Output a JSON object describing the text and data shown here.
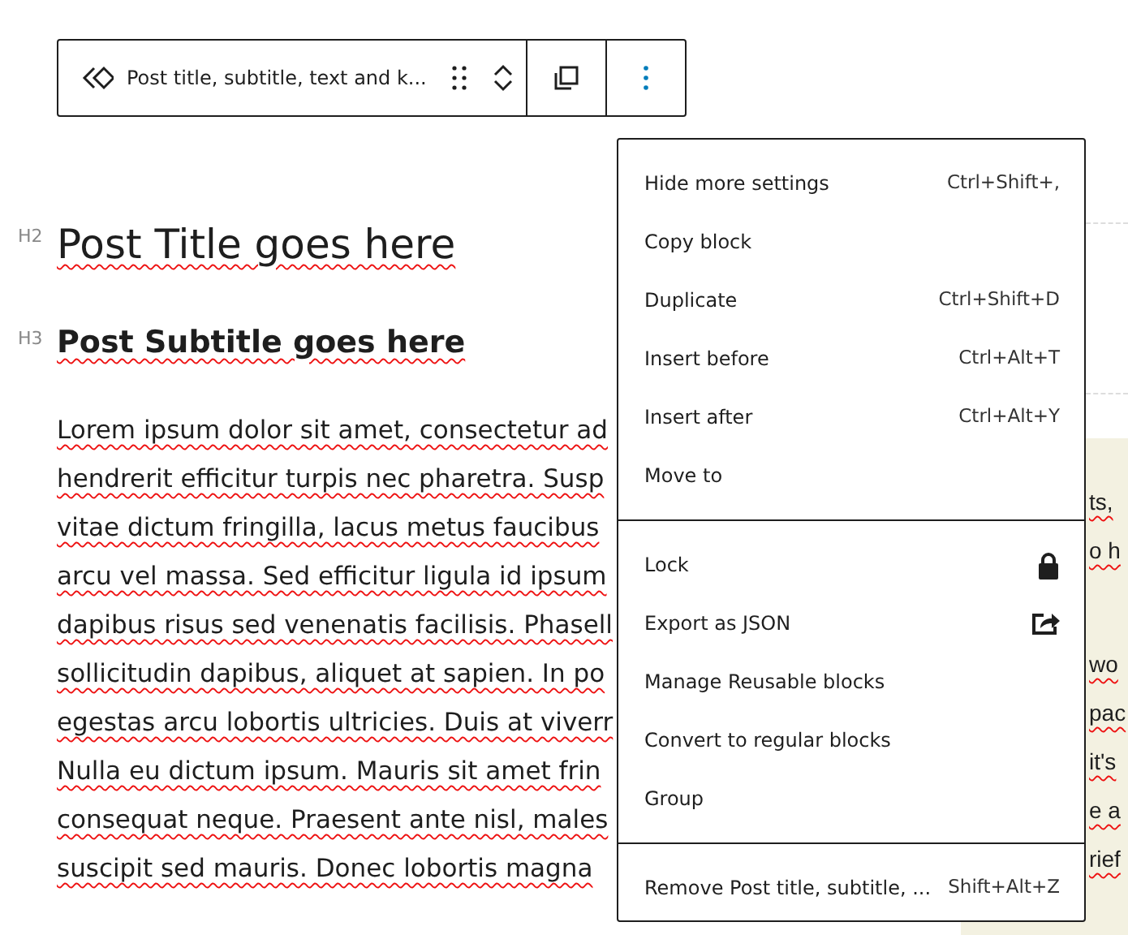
{
  "toolbar": {
    "block_label": "Post title, subtitle, text and k...",
    "more_active": true
  },
  "title": {
    "level": "H2",
    "text": "Post Title goes here"
  },
  "subtitle": {
    "level": "H3",
    "text": "Post Subtitle goes here"
  },
  "paragraph_lines": [
    "Lorem ipsum dolor sit amet, consectetur ad",
    "hendrerit efficitur turpis nec pharetra. Susp",
    "vitae dictum fringilla, lacus metus faucibus",
    "arcu vel massa. Sed efficitur ligula id ipsum",
    "dapibus risus sed venenatis facilisis. Phasell",
    "sollicitudin dapibus, aliquet at sapien. In po",
    "egestas arcu lobortis ultricies. Duis at viverr",
    "Nulla eu dictum ipsum. Mauris sit amet frin",
    "consequat neque. Praesent ante nisl, males",
    "suscipit sed mauris. Donec lobortis magna"
  ],
  "side_text_groups": [
    [
      "ts,",
      "o h"
    ],
    [
      "wo",
      "pac",
      "it's",
      "e a",
      "rief"
    ]
  ],
  "menu": {
    "sections": [
      [
        {
          "label": "Hide more settings",
          "shortcut": "Ctrl+Shift+,"
        },
        {
          "label": "Copy block"
        },
        {
          "label": "Duplicate",
          "shortcut": "Ctrl+Shift+D"
        },
        {
          "label": "Insert before",
          "shortcut": "Ctrl+Alt+T"
        },
        {
          "label": "Insert after",
          "shortcut": "Ctrl+Alt+Y"
        },
        {
          "label": "Move to"
        }
      ],
      [
        {
          "label": "Lock"
        },
        {
          "label": "Export as JSON"
        },
        {
          "label": "Manage Reusable blocks"
        },
        {
          "label": "Convert to regular blocks"
        },
        {
          "label": "Group"
        }
      ],
      [
        {
          "label": "Remove Post title, subtitle, ...",
          "shortcut": "Shift+Alt+Z"
        }
      ]
    ]
  }
}
